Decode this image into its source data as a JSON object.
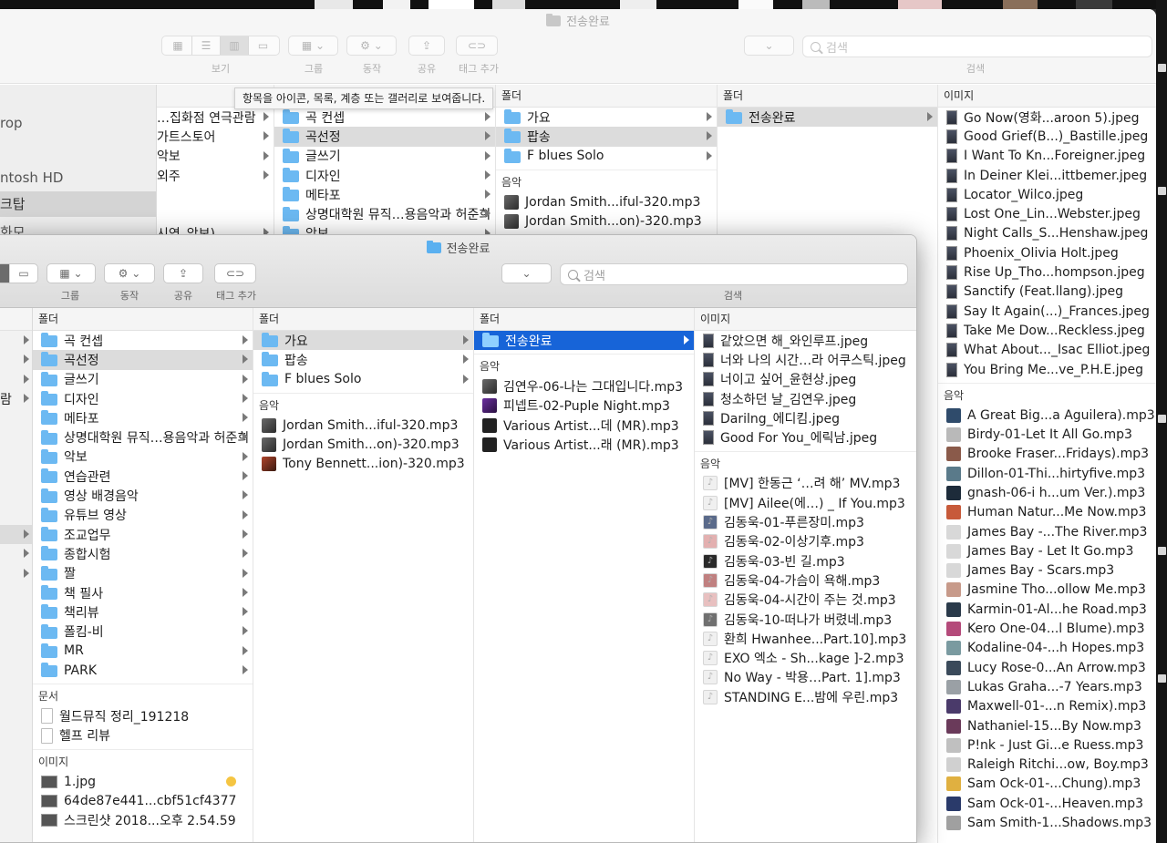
{
  "back_window": {
    "title": "전송완료",
    "toolbar_labels": {
      "view": "보기",
      "group": "그룹",
      "action": "동작",
      "share": "공유",
      "tags": "태그 추가",
      "search": "검색"
    },
    "search_placeholder": "검색",
    "tooltip": "항목을 아이콘, 목록, 계층 또는 갤러리로 보여줍니다.",
    "sidebar": [
      "rop",
      "ntosh HD",
      "크탑",
      "화모"
    ],
    "col0_items": [
      "…집화점 연극관람",
      "가트스토어",
      "악보",
      "외주",
      "시연_악보)"
    ],
    "col1_items": [
      "곡 컨셉",
      "곡선정",
      "글쓰기",
      "디자인",
      "메타포",
      "상명대학원 뮤직…용음악과 허준희",
      "악보"
    ],
    "col2": {
      "header": "폴더",
      "folders": [
        "가요",
        "팝송",
        "F blues Solo"
      ],
      "music_header": "음악",
      "music": [
        "Jordan Smith...iful-320.mp3",
        "Jordan Smith...on)-320.mp3"
      ]
    },
    "col3": {
      "header": "폴더",
      "folders": [
        "전송완료"
      ]
    },
    "col4": {
      "header": "이미지",
      "images": [
        "Go Now(영화...aroon 5).jpeg",
        "Good Grief(B...)_Bastille.jpeg",
        "I Want To Kn...Foreigner.jpeg",
        "In Deiner Klei...ittbemer.jpeg",
        "Locator_Wilco.jpeg",
        "Lost One_Lin...Webster.jpeg",
        "Night Calls_S...Henshaw.jpeg",
        "Phoenix_Olivia Holt.jpeg",
        "Rise Up_Tho...hompson.jpeg",
        "Sanctify (Feat.llang).jpeg",
        "Say It Again(...)_Frances.jpeg",
        "Take Me Dow...Reckless.jpeg",
        "What About..._Isac Elliot.jpeg",
        "You Bring Me...ve_P.H.E.jpeg"
      ],
      "music_header": "음악",
      "music": [
        "A Great Big...a Aguilera).mp3",
        "Birdy-01-Let It All Go.mp3",
        "Brooke Fraser...Fridays).mp3",
        "Dillon-01-Thi...hirtyfive.mp3",
        "gnash-06-i h...um Ver.).mp3",
        "Human Natur...Me Now.mp3",
        "James Bay -...The River.mp3",
        "James Bay - Let It Go.mp3",
        "James Bay - Scars.mp3",
        "Jasmine Tho...ollow Me.mp3",
        "Karmin-01-Al...he Road.mp3",
        "Kero One-04...l Blume).mp3",
        "Kodaline-04-...h Hopes.mp3",
        "Lucy Rose-0...An Arrow.mp3",
        "Lukas Graha...-7 Years.mp3",
        "Maxwell-01-...n Remix).mp3",
        "Nathaniel-15...By Now.mp3",
        "P!nk - Just Gi...e Ruess.mp3",
        "Raleigh Ritchi...ow, Boy.mp3",
        "Sam Ock-01-...Chung).mp3",
        "Sam Ock-01-...Heaven.mp3",
        "Sam Smith-1...Shadows.mp3"
      ]
    }
  },
  "front_window": {
    "title": "전송완료",
    "toolbar_labels": {
      "group": "그룹",
      "action": "동작",
      "share": "공유",
      "tags": "태그 추가",
      "search": "검색"
    },
    "search_placeholder": "검색",
    "side_fragments": [
      "람"
    ],
    "col1": {
      "header": "폴더",
      "folders": [
        "곡 컨셉",
        "곡선정",
        "글쓰기",
        "디자인",
        "메타포",
        "상명대학원 뮤직…용음악과 허준희",
        "악보",
        "연습관련",
        "영상 배경음악",
        "유튜브 영상",
        "조교업무",
        "종합시험",
        "짤",
        "책 필사",
        "책리뷰",
        "폴킴-비",
        "MR",
        "PARK"
      ],
      "docs_header": "문서",
      "docs": [
        "월드뮤직 정리_191218",
        "헬프 리뷰"
      ],
      "images_header": "이미지",
      "images": [
        "1.jpg",
        "64de87e441...cbf51cf4377",
        "스크린샷 2018...오후 2.54.59"
      ]
    },
    "col2": {
      "header": "폴더",
      "folders": [
        "가요",
        "팝송",
        "F blues Solo"
      ],
      "music_header": "음악",
      "music": [
        "Jordan Smith...iful-320.mp3",
        "Jordan Smith...on)-320.mp3",
        "Tony Bennett...ion)-320.mp3"
      ]
    },
    "col3": {
      "header": "폴더",
      "folders": [
        "전송완료"
      ],
      "music_header": "음악",
      "music": [
        "김연우-06-나는 그대입니다.mp3",
        "피넵트-02-Puple Night.mp3",
        "Various Artist...데 (MR).mp3",
        "Various Artist...래 (MR).mp3"
      ]
    },
    "col4": {
      "header": "이미지",
      "images": [
        "같았으면 해_와인루프.jpeg",
        "너와 나의 시간…라 어쿠스틱.jpeg",
        "너이고 싶어_윤현상.jpeg",
        "청소하던 날_김연우.jpeg",
        "Darilng_에디킴.jpeg",
        "Good For You_에릭남.jpeg"
      ],
      "music_header": "음악",
      "music": [
        "[MV] 한동근 ‘…려 해’ MV.mp3",
        "[MV] Ailee(에…) _ If You.mp3",
        "김동욱-01-푸른장미.mp3",
        "김동욱-02-이상기후.mp3",
        "김동욱-03-빈 길.mp3",
        "김동욱-04-가슴이 욕해.mp3",
        "김동욱-04-시간이 주는 것.mp3",
        "김동욱-10-떠나가 버렸네.mp3",
        "환희 Hwanhee...Part.10].mp3",
        "EXO 엑소 - Sh...kage ]-2.mp3",
        "No Way - 박용…Part. 1].mp3",
        "STANDING E...밤에 우린.mp3"
      ]
    }
  }
}
